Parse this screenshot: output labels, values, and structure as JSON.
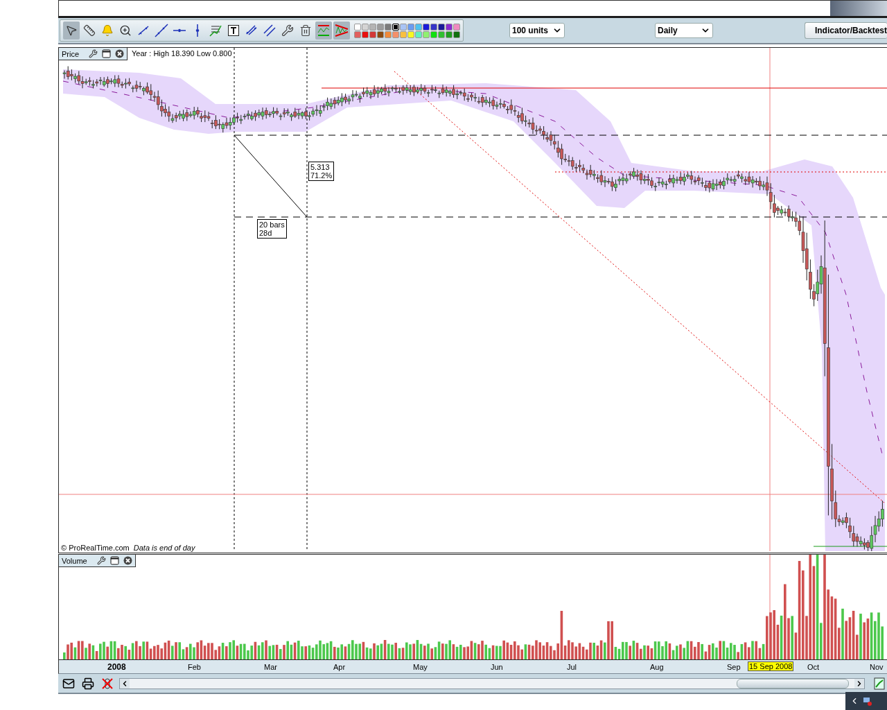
{
  "toolbar": {
    "tools": [
      {
        "kind": "pointer",
        "selected": true
      },
      {
        "kind": "ruler",
        "selected": false
      },
      {
        "kind": "alert",
        "selected": false
      },
      {
        "kind": "zoom",
        "selected": false
      },
      {
        "kind": "segment",
        "selected": false
      },
      {
        "kind": "line",
        "selected": false
      },
      {
        "kind": "horizontal",
        "selected": false
      },
      {
        "kind": "vertical",
        "selected": false
      },
      {
        "kind": "fibonacci",
        "selected": false
      },
      {
        "kind": "text",
        "selected": false
      },
      {
        "kind": "channel",
        "selected": false
      },
      {
        "kind": "parallel",
        "selected": false
      },
      {
        "kind": "tools",
        "selected": false
      },
      {
        "kind": "delete",
        "selected": false
      },
      {
        "kind": "indicator",
        "selected": true
      },
      {
        "kind": "triangle",
        "selected": true
      }
    ],
    "palette": [
      {
        "color": "#ffffff",
        "selected": false
      },
      {
        "color": "#d4d4d4",
        "selected": false
      },
      {
        "color": "#b4b4b4",
        "selected": false
      },
      {
        "color": "#9c9c9c",
        "selected": false
      },
      {
        "color": "#7c7c7c",
        "selected": false
      },
      {
        "color": "#000000",
        "selected": true
      },
      {
        "color": "#a9c4f5",
        "selected": false
      },
      {
        "color": "#6b9cf0",
        "selected": false
      },
      {
        "color": "#4fc3f0",
        "selected": false
      },
      {
        "color": "#1b1bd9",
        "selected": false
      },
      {
        "color": "#3535c8",
        "selected": false
      },
      {
        "color": "#1a1a99",
        "selected": false
      },
      {
        "color": "#8a2bd0",
        "selected": false
      },
      {
        "color": "#f08ac0",
        "selected": false
      },
      {
        "color": "#e06060",
        "selected": false
      },
      {
        "color": "#e81010",
        "selected": false
      },
      {
        "color": "#d23838",
        "selected": false
      },
      {
        "color": "#8b4a10",
        "selected": false
      },
      {
        "color": "#f08a3a",
        "selected": false
      },
      {
        "color": "#f4906a",
        "selected": false
      },
      {
        "color": "#f8c040",
        "selected": false
      },
      {
        "color": "#f8f820",
        "selected": false
      },
      {
        "color": "#60f0c0",
        "selected": false
      },
      {
        "color": "#90f070",
        "selected": false
      },
      {
        "color": "#10e010",
        "selected": false
      },
      {
        "color": "#30c030",
        "selected": false
      },
      {
        "color": "#20a020",
        "selected": false
      },
      {
        "color": "#107010",
        "selected": false
      }
    ],
    "quantity": "100 units",
    "period": "Daily",
    "indicator_button": "Indicator/Backtest"
  },
  "price_panel": {
    "title": "Price",
    "info": "Year : High 18.390 Low 0.800",
    "annotations": [
      {
        "lines": [
          "5.313",
          "71.2%"
        ]
      },
      {
        "lines": [
          "20 bars",
          "28d"
        ]
      }
    ],
    "copyright": "© ProRealTime.com",
    "note": "Data is end of day"
  },
  "volume_panel": {
    "title": "Volume"
  },
  "time_axis": {
    "labels": [
      {
        "text": "2008",
        "kind": "year"
      },
      {
        "text": "Feb",
        "kind": "month"
      },
      {
        "text": "Mar",
        "kind": "month"
      },
      {
        "text": "Apr",
        "kind": "month"
      },
      {
        "text": "May",
        "kind": "month"
      },
      {
        "text": "Jun",
        "kind": "month"
      },
      {
        "text": "Jul",
        "kind": "month"
      },
      {
        "text": "Aug",
        "kind": "month"
      },
      {
        "text": "Sep",
        "kind": "month"
      },
      {
        "text": "Oct",
        "kind": "month"
      },
      {
        "text": "Nov",
        "kind": "month"
      }
    ],
    "cursor_label": "15 Sep 2008"
  }
}
